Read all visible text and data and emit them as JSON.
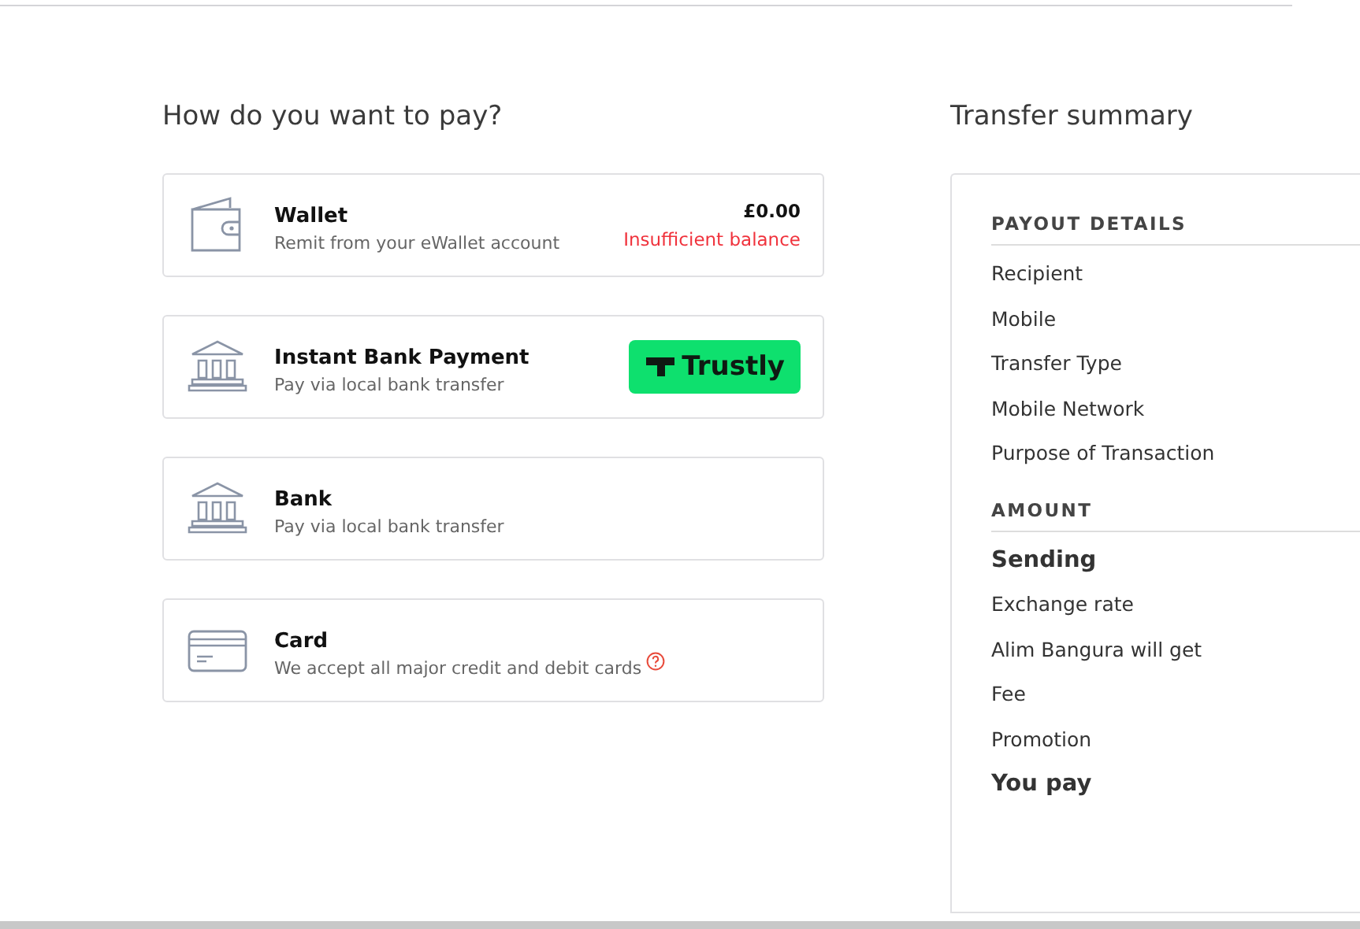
{
  "payment": {
    "heading": "How do you want to pay?",
    "methods": [
      {
        "kind": "wallet",
        "title": "Wallet",
        "subtitle": "Remit from your eWallet account",
        "amount": "£0.00",
        "warning": "Insufficient balance"
      },
      {
        "kind": "bank",
        "title": "Instant Bank Payment",
        "subtitle": "Pay via local bank transfer",
        "badge": "Trustly"
      },
      {
        "kind": "bank",
        "title": "Bank",
        "subtitle": "Pay via local bank transfer"
      },
      {
        "kind": "card",
        "title": "Card",
        "subtitle": "We accept all major credit and debit cards",
        "help": true
      }
    ]
  },
  "summary": {
    "heading": "Transfer summary",
    "sections": [
      {
        "title": "PAYOUT DETAILS",
        "rows": [
          {
            "label": "Recipient",
            "strong": false
          },
          {
            "label": "Mobile",
            "strong": false
          },
          {
            "label": "Transfer Type",
            "strong": false
          },
          {
            "label": "Mobile Network",
            "strong": false
          },
          {
            "label": "Purpose of Transaction",
            "strong": false
          }
        ]
      },
      {
        "title": "AMOUNT",
        "rows": [
          {
            "label": "Sending",
            "strong": true
          },
          {
            "label": "Exchange rate",
            "strong": false
          },
          {
            "label": "Alim Bangura will get",
            "strong": false
          },
          {
            "label": "Fee",
            "strong": false
          },
          {
            "label": "Promotion",
            "strong": false
          },
          {
            "label": "You pay",
            "strong": true
          }
        ]
      }
    ]
  }
}
